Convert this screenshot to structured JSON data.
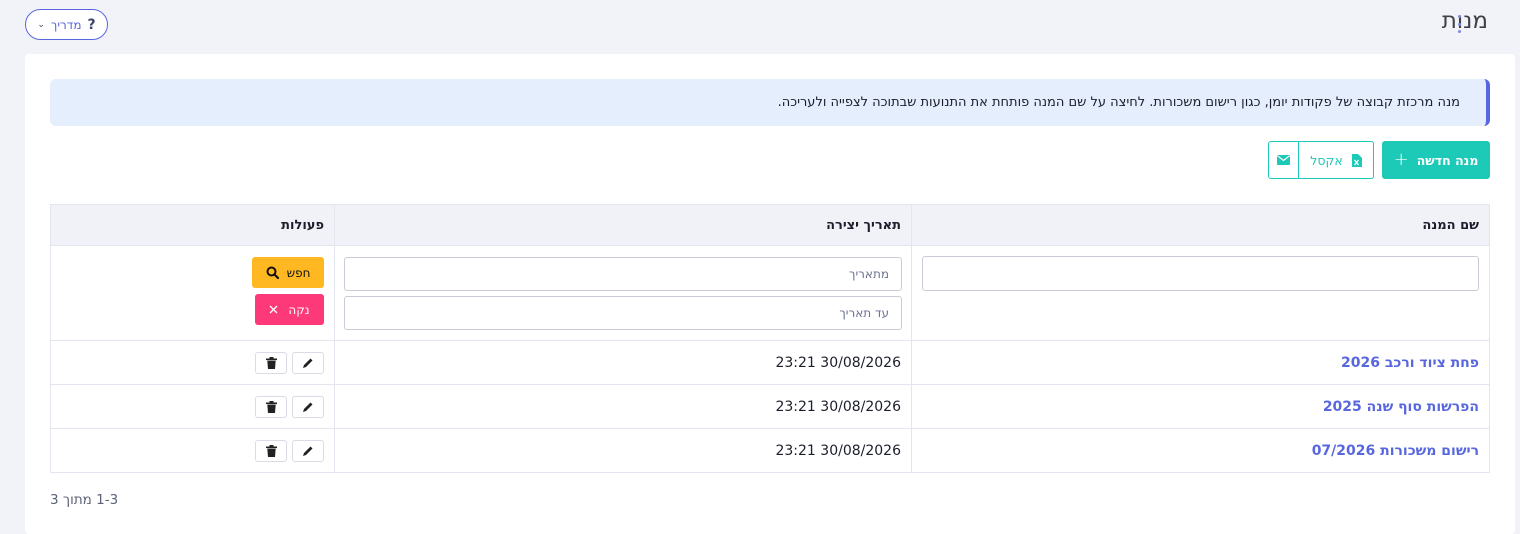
{
  "header": {
    "title": "מנות",
    "guide_label": "מדריך",
    "guide_q": "?"
  },
  "info": {
    "text": "מנה מרכזת קבוצה של פקודות יומן, כגון רישום משכורות. לחיצה על שם המנה פותחת את התנועות שבתוכה לצפייה ולעריכה."
  },
  "toolbar": {
    "new_label": "מנה חדשה",
    "excel_label": "אקסל"
  },
  "table": {
    "columns": [
      "שם המנה",
      "תאריך יצירה",
      "פעולות"
    ],
    "filters": {
      "from_placeholder": "מתאריך",
      "to_placeholder": "עד תאריך",
      "search_label": "חפש",
      "clear_label": "נקה"
    },
    "rows": [
      {
        "name": "פחת ציוד ורכב 2026",
        "date": "30/08/2026 23:21"
      },
      {
        "name": "הפרשות סוף שנה 2025",
        "date": "30/08/2026 23:21"
      },
      {
        "name": "רישום משכורות 07/2026",
        "date": "30/08/2026 23:21"
      }
    ]
  },
  "pager": {
    "text": "1-3 מתוך 3"
  },
  "colors": {
    "primary": "#5867dd",
    "success": "#1dc9b7",
    "warning": "#ffb822",
    "danger": "#fd397a"
  }
}
